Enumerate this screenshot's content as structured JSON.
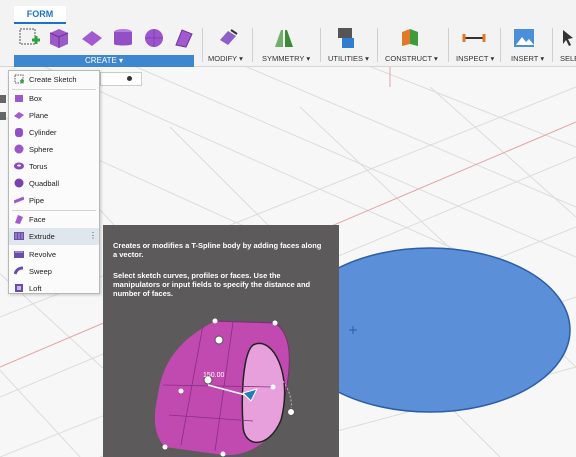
{
  "toolbar": {
    "tab_form": "FORM",
    "create_label": "CREATE ▾",
    "modify_label": "MODIFY ▾",
    "symmetry_label": "SYMMETRY ▾",
    "utilities_label": "UTILITIES ▾",
    "construct_label": "CONSTRUCT ▾",
    "inspect_label": "INSPECT ▾",
    "insert_label": "INSERT ▾",
    "select_label": "SELE"
  },
  "create_menu": {
    "items": [
      {
        "label": "Create Sketch",
        "icon": "create-sketch-icon"
      },
      {
        "label": "Box",
        "icon": "box-icon"
      },
      {
        "label": "Plane",
        "icon": "plane-icon"
      },
      {
        "label": "Cylinder",
        "icon": "cylinder-icon"
      },
      {
        "label": "Sphere",
        "icon": "sphere-icon"
      },
      {
        "label": "Torus",
        "icon": "torus-icon"
      },
      {
        "label": "Quadball",
        "icon": "quadball-icon"
      },
      {
        "label": "Pipe",
        "icon": "pipe-icon"
      },
      {
        "label": "Face",
        "icon": "face-icon"
      },
      {
        "label": "Extrude",
        "icon": "extrude-icon"
      },
      {
        "label": "Revolve",
        "icon": "revolve-icon"
      },
      {
        "label": "Sweep",
        "icon": "sweep-icon"
      },
      {
        "label": "Loft",
        "icon": "loft-icon"
      }
    ],
    "highlighted": "Extrude"
  },
  "tooltip": {
    "description": "Creates or modifies a T-Spline body by adding faces along a vector.",
    "instructions": "Select sketch curves, profiles or faces. Use the manipulators or input fields to specify the distance and number of faces.",
    "dimension_value": "150.00"
  },
  "colors": {
    "accent": "#3f86d0",
    "tooltip_bg": "#5c5a5a",
    "profile_fill": "#5b8fd8",
    "tspline_body": "#c04ab0"
  }
}
